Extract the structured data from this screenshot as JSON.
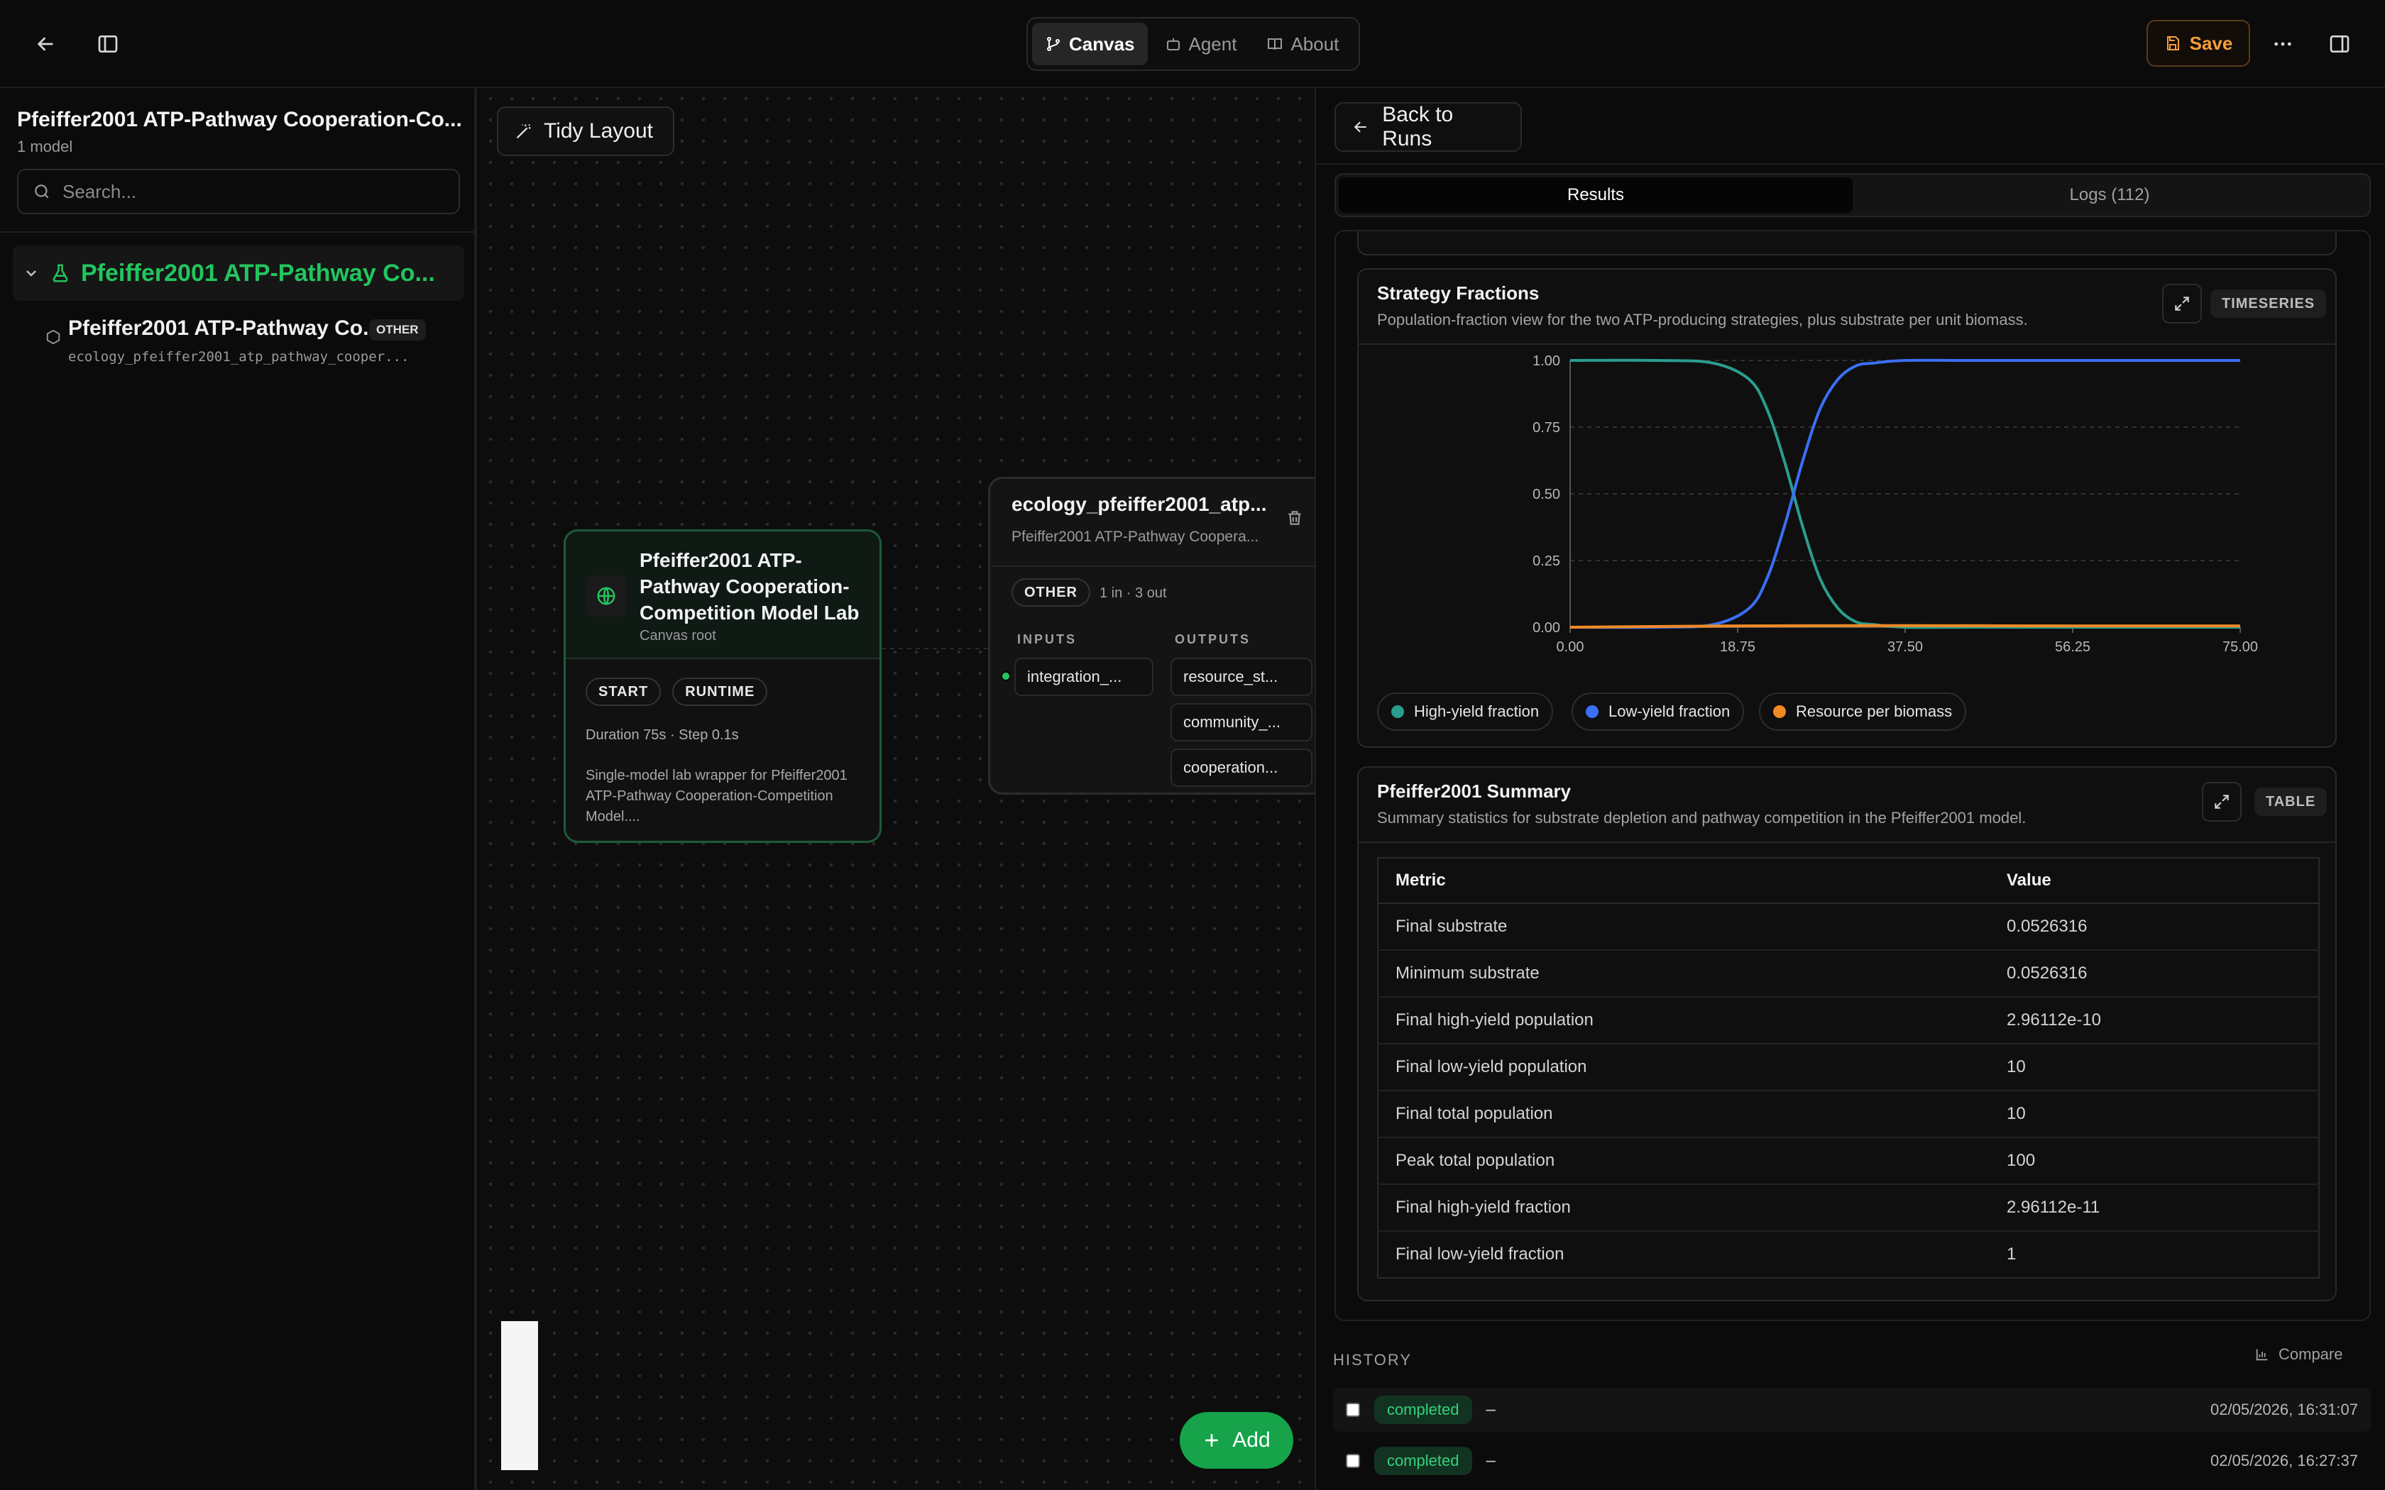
{
  "topbar": {
    "tabs": [
      {
        "label": "Canvas",
        "active": true
      },
      {
        "label": "Agent",
        "active": false
      },
      {
        "label": "About",
        "active": false
      }
    ],
    "save_label": "Save"
  },
  "sidebar": {
    "project_title": "Pfeiffer2001 ATP-Pathway Cooperation-Co...",
    "project_sub": "1 model",
    "search_placeholder": "Search...",
    "tree_root_label": "Pfeiffer2001 ATP-Pathway Co...",
    "tree_child": {
      "name": "Pfeiffer2001 ATP-Pathway Co...",
      "badge": "OTHER",
      "id": "ecology_pfeiffer2001_atp_pathway_cooper..."
    }
  },
  "canvas": {
    "tidy_label": "Tidy Layout",
    "add_label": "Add",
    "root_node": {
      "title": "Pfeiffer2001 ATP-Pathway Cooperation-Competition Model Lab",
      "subtitle": "Canvas root",
      "tags": [
        "START",
        "RUNTIME"
      ],
      "meta": "Duration 75s · Step 0.1s",
      "desc": "Single-model lab wrapper for Pfeiffer2001 ATP-Pathway Cooperation-Competition Model...."
    },
    "model_node": {
      "title": "ecology_pfeiffer2001_atp...",
      "subtitle": "Pfeiffer2001 ATP-Pathway Coopera...",
      "badge": "OTHER",
      "io": "1 in · 3 out",
      "inputs_label": "INPUTS",
      "outputs_label": "OUTPUTS",
      "inputs": [
        "integration_..."
      ],
      "outputs": [
        "resource_st...",
        "community_...",
        "cooperation..."
      ]
    }
  },
  "results": {
    "back_label": "Back to Runs",
    "tabs": [
      {
        "label": "Results",
        "active": true
      },
      {
        "label": "Logs (112)",
        "active": false
      }
    ],
    "chart_card": {
      "title": "Strategy Fractions",
      "desc": "Population-fraction view for the two ATP-producing strategies, plus substrate per unit biomass.",
      "tag": "TIMESERIES"
    },
    "table_card": {
      "title": "Pfeiffer2001 Summary",
      "desc": "Summary statistics for substrate depletion and pathway competition in the Pfeiffer2001 model.",
      "tag": "TABLE",
      "headers": [
        "Metric",
        "Value"
      ],
      "rows": [
        [
          "Final substrate",
          "0.0526316"
        ],
        [
          "Minimum substrate",
          "0.0526316"
        ],
        [
          "Final high-yield population",
          "2.96112e-10"
        ],
        [
          "Final low-yield population",
          "10"
        ],
        [
          "Final total population",
          "10"
        ],
        [
          "Peak total population",
          "100"
        ],
        [
          "Final high-yield fraction",
          "2.96112e-11"
        ],
        [
          "Final low-yield fraction",
          "1"
        ]
      ]
    },
    "history": {
      "label": "HISTORY",
      "compare_label": "Compare",
      "rows": [
        {
          "status": "completed",
          "dash": "–",
          "time": "02/05/2026, 16:31:07"
        },
        {
          "status": "completed",
          "dash": "–",
          "time": "02/05/2026, 16:27:37"
        }
      ]
    }
  },
  "chart_data": {
    "type": "line",
    "x_ticks": [
      "0.00",
      "18.75",
      "37.50",
      "56.25",
      "75.00"
    ],
    "y_ticks": [
      "0.00",
      "0.25",
      "0.50",
      "0.75",
      "1.00"
    ],
    "xlim": [
      0,
      75
    ],
    "ylim": [
      0,
      1
    ],
    "grid": "horizontal dashed",
    "legend_position": "bottom",
    "series": [
      {
        "name": "High-yield fraction",
        "color": "#2a9d8f",
        "x": [
          0,
          10,
          16,
          20,
          22,
          24,
          26,
          28,
          30,
          32,
          34,
          37.5,
          45,
          56.25,
          75
        ],
        "y": [
          1.0,
          1.0,
          0.99,
          0.93,
          0.82,
          0.62,
          0.38,
          0.18,
          0.07,
          0.02,
          0.01,
          0.0,
          0.0,
          0.0,
          0.0
        ]
      },
      {
        "name": "Low-yield fraction",
        "color": "#3b6ff5",
        "x": [
          0,
          10,
          16,
          20,
          22,
          24,
          26,
          28,
          30,
          32,
          34,
          37.5,
          45,
          56.25,
          75
        ],
        "y": [
          0.0,
          0.0,
          0.01,
          0.07,
          0.18,
          0.38,
          0.62,
          0.82,
          0.93,
          0.98,
          0.99,
          1.0,
          1.0,
          1.0,
          1.0
        ]
      },
      {
        "name": "Resource per biomass",
        "color": "#f08a24",
        "x": [
          0,
          18.75,
          37.5,
          56.25,
          75
        ],
        "y": [
          0.0,
          0.005,
          0.006,
          0.005,
          0.005
        ]
      }
    ]
  }
}
